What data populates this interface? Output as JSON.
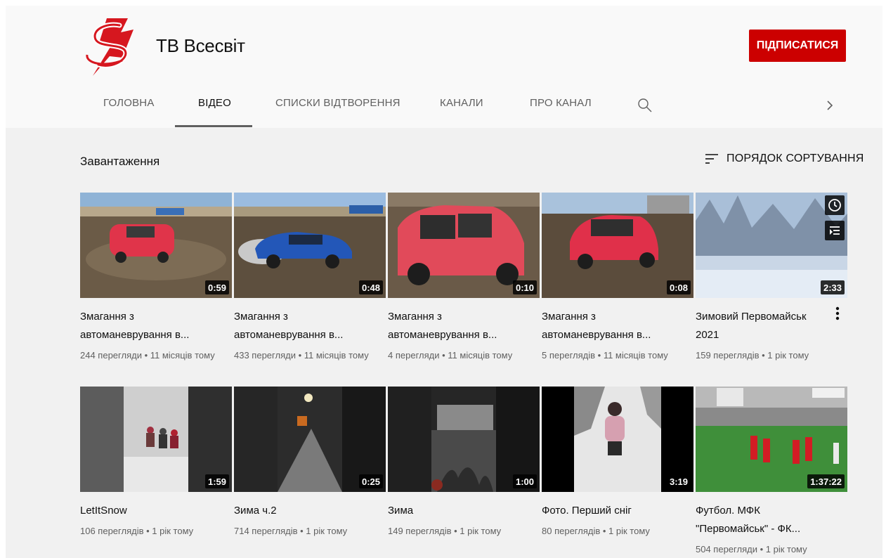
{
  "channel": {
    "name": "ТВ Всесвіт",
    "subscribe_label": "ПІДПИСАТИСЯ"
  },
  "tabs": [
    {
      "label": "ГОЛОВНА"
    },
    {
      "label": "ВІДЕО"
    },
    {
      "label": "СПИСКИ ВІДТВОРЕННЯ"
    },
    {
      "label": "КАНАЛИ"
    },
    {
      "label": "ПРО КАНАЛ"
    }
  ],
  "section": {
    "title": "Завантаження",
    "sort_label": "ПОРЯДОК СОРТУВАННЯ"
  },
  "videos": [
    {
      "title_line1": "Змагання з",
      "title_line2": "автоманеврування в...",
      "duration": "0:59",
      "views": "244 перегляди",
      "age": "11 місяців тому"
    },
    {
      "title_line1": "Змагання з",
      "title_line2": "автоманеврування в...",
      "duration": "0:48",
      "views": "433 перегляди",
      "age": "11 місяців тому"
    },
    {
      "title_line1": "Змагання з",
      "title_line2": "автоманеврування в...",
      "duration": "0:10",
      "views": "4 перегляди",
      "age": "11 місяців тому"
    },
    {
      "title_line1": "Змагання з",
      "title_line2": "автоманеврування в...",
      "duration": "0:08",
      "views": "5 переглядів",
      "age": "11 місяців тому"
    },
    {
      "title_line1": "Зимовий Первомайськ",
      "title_line2": "2021",
      "duration": "2:33",
      "views": "159 переглядів",
      "age": "1 рік тому"
    },
    {
      "title_line1": "LetItSnow",
      "title_line2": "",
      "duration": "1:59",
      "views": "106 переглядів",
      "age": "1 рік тому"
    },
    {
      "title_line1": "Зима ч.2",
      "title_line2": "",
      "duration": "0:25",
      "views": "714 переглядів",
      "age": "1 рік тому"
    },
    {
      "title_line1": "Зима",
      "title_line2": "",
      "duration": "1:00",
      "views": "149 переглядів",
      "age": "1 рік тому"
    },
    {
      "title_line1": "Фото. Перший сніг",
      "title_line2": "",
      "duration": "3:19",
      "views": "80 переглядів",
      "age": "1 рік тому"
    },
    {
      "title_line1": "Футбол. МФК",
      "title_line2": "\"Первомайськ\" - ФК...",
      "duration": "1:37:22",
      "views": "504 перегляди",
      "age": "1 рік тому"
    }
  ],
  "meta_separator": " • ",
  "icons": {
    "search": "search-icon",
    "next": "chevron-right-icon",
    "sort": "sort-icon",
    "watch_later": "clock-icon",
    "add_to_queue": "queue-icon",
    "more": "more-vert-icon"
  },
  "colors": {
    "accent": "#cc0000"
  }
}
